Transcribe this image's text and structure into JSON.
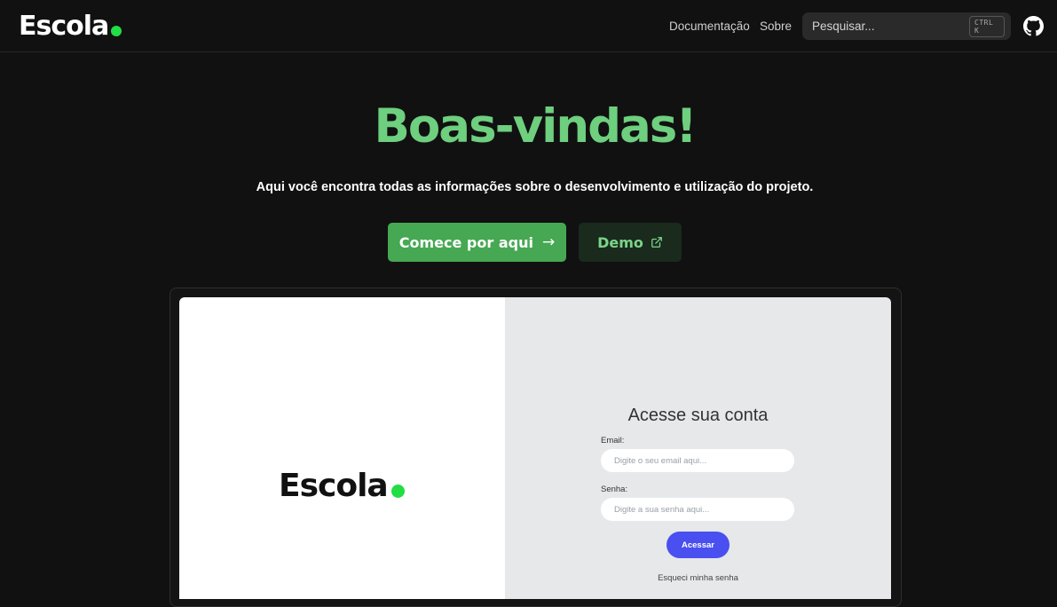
{
  "header": {
    "logo_text": "Escola",
    "nav": {
      "docs_label": "Documentação",
      "about_label": "Sobre"
    },
    "search": {
      "placeholder": "Pesquisar...",
      "shortcut": "CTRL K"
    },
    "github_icon": "github-icon"
  },
  "hero": {
    "title": "Boas-vindas!",
    "subtitle": "Aqui você encontra todas as informações sobre o desenvolvimento e utilização do projeto.",
    "primary_button": {
      "label": "Comece por aqui",
      "icon": "arrow-right-icon"
    },
    "demo_button": {
      "label": "Demo",
      "icon": "external-link-icon"
    }
  },
  "preview": {
    "logo_text": "Escola",
    "login": {
      "title": "Acesse sua conta",
      "email_label": "Email:",
      "email_placeholder": "Digite o seu email aqui...",
      "password_label": "Senha:",
      "password_placeholder": "Digite a sua senha aqui...",
      "submit_label": "Acessar",
      "forgot_label": "Esqueci minha senha"
    }
  },
  "colors": {
    "background": "#111111",
    "accent_green": "#6ecf7f",
    "button_green": "#46a853",
    "logo_dot": "#22dd44",
    "login_button": "#4a4ff0"
  }
}
